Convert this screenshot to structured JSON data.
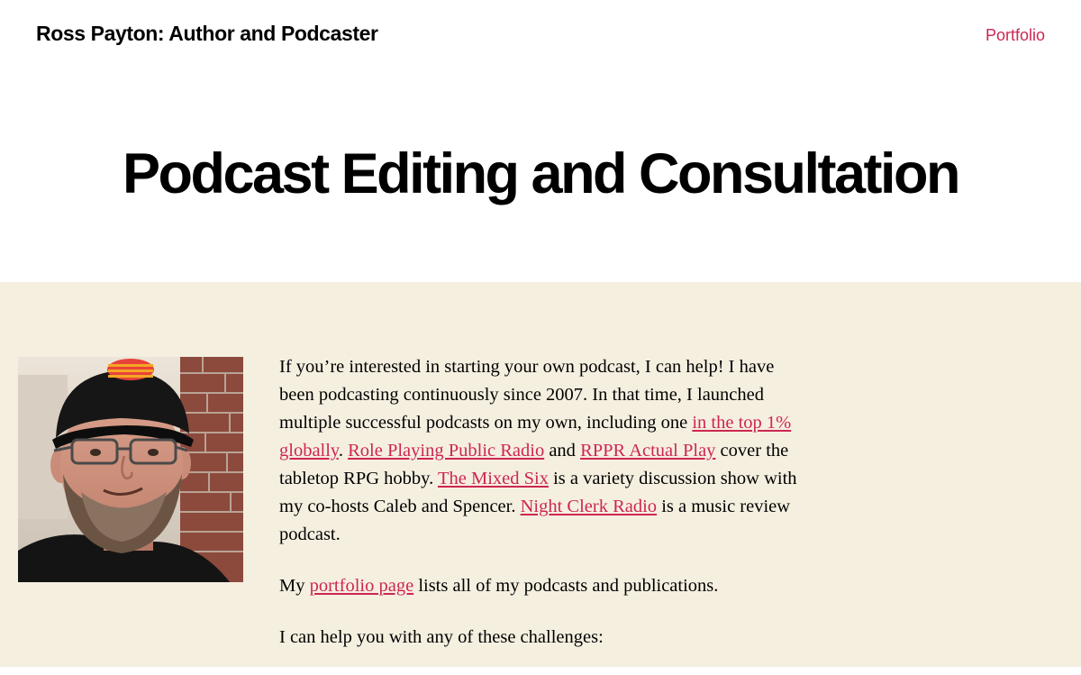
{
  "header": {
    "site_title": "Ross Payton: Author and Podcaster",
    "nav": {
      "portfolio_label": "Portfolio"
    }
  },
  "page": {
    "title": "Podcast Editing and Consultation"
  },
  "content": {
    "intro": {
      "t1": "If you’re interested in starting your own podcast, I can help! I have been podcasting continuously since 2007. In that time, I launched multiple successful podcasts on my own, including one ",
      "link_top1": "in the top 1% globally",
      "t2": ". ",
      "link_rppr": "Role Playing Public Radio",
      "t3": " and ",
      "link_rppr_actual_play": "RPPR Actual Play",
      "t4": " cover the tabletop RPG hobby. ",
      "link_mixed_six": "The Mixed Six",
      "t5": " is a variety discussion show with my co-hosts Caleb and Spencer. ",
      "link_night_clerk": "Night Clerk Radio",
      "t6": " is a music review podcast."
    },
    "portfolio_para": {
      "t1": "My ",
      "link": "portfolio page",
      "t2": " lists all of my podcasts and publications."
    },
    "challenges_para": "I can help you with any of these challenges:"
  },
  "colors": {
    "accent": "#cd2653",
    "content_bg": "#f5efe0",
    "text": "#000000"
  }
}
